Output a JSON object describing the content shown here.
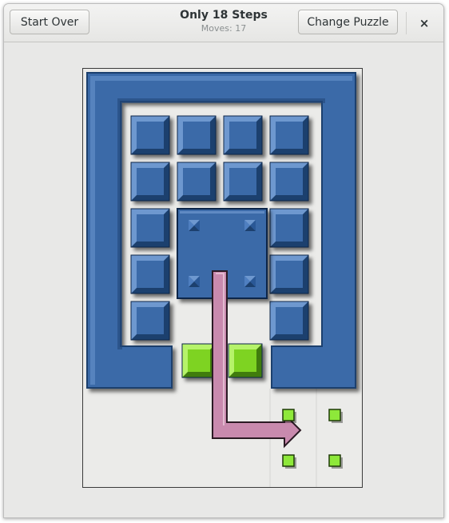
{
  "header": {
    "start_over_label": "Start Over",
    "title": "Only 18 Steps",
    "moves_text": "Moves: 17",
    "change_puzzle_label": "Change Puzzle",
    "close_glyph": "×"
  },
  "colors": {
    "block_blue": "#3a6aa8",
    "block_edge_light": "#6e98cf",
    "block_edge_dark": "#1e3f6e",
    "green_piece": "#7ed321",
    "arrow_pink": "#c98aae",
    "target_marker": "#8ee83a"
  },
  "icons": [
    "close-icon",
    "arrow-hint-icon",
    "target-marker-icon"
  ],
  "puzzle": {
    "grid_cols": 4,
    "grid_rows": 5,
    "small_blocks": [
      {
        "col": 0,
        "row": 0
      },
      {
        "col": 1,
        "row": 0
      },
      {
        "col": 2,
        "row": 0
      },
      {
        "col": 3,
        "row": 0
      },
      {
        "col": 0,
        "row": 1
      },
      {
        "col": 1,
        "row": 1
      },
      {
        "col": 2,
        "row": 1
      },
      {
        "col": 3,
        "row": 1
      },
      {
        "col": 0,
        "row": 2
      },
      {
        "col": 3,
        "row": 2
      },
      {
        "col": 0,
        "row": 3
      },
      {
        "col": 3,
        "row": 3
      },
      {
        "col": 0,
        "row": 4
      },
      {
        "col": 3,
        "row": 4
      }
    ],
    "big_block": {
      "col": 1,
      "row": 2,
      "width": 2,
      "height": 2
    },
    "green_pieces": [
      {
        "col": 1,
        "row": 5
      },
      {
        "col": 2,
        "row": 5
      }
    ],
    "exit_targets": 4,
    "hint_arrow": "down-then-right"
  }
}
